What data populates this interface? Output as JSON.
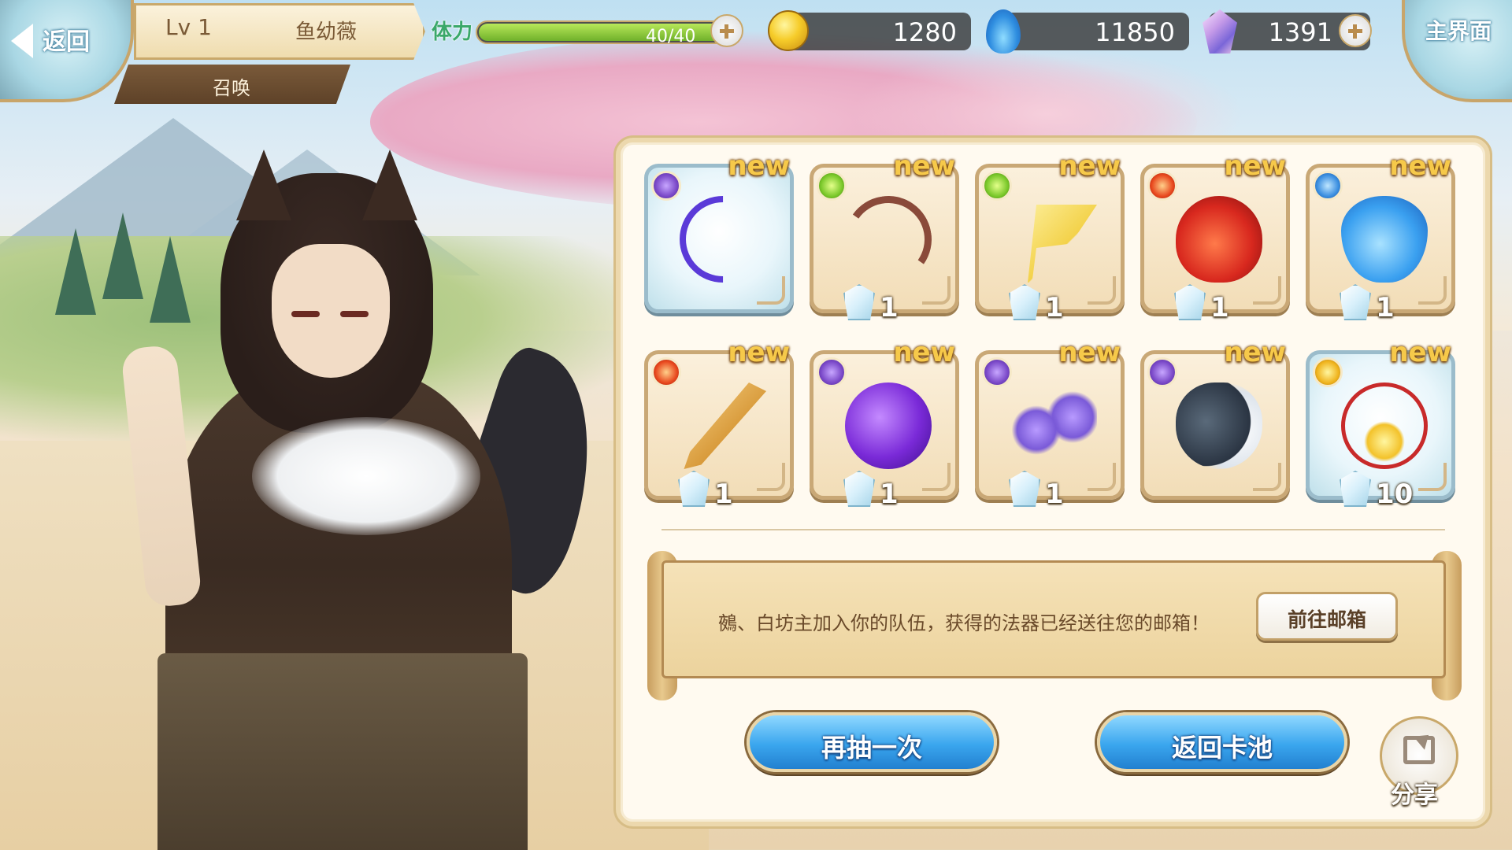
{
  "hud": {
    "back_label": "返回",
    "level": "Lv 1",
    "player_name": "鱼幼薇",
    "mode": "召唤",
    "stamina_label": "体力",
    "stamina_text": "40/40",
    "stamina_fraction": 1.0,
    "gold": "1280",
    "spirit": "11850",
    "crystal": "1391",
    "home_label": "主界面"
  },
  "rewards": [
    {
      "new_label": "new",
      "element": "purple",
      "art": "bow-purple",
      "rarity": "rare",
      "count": ""
    },
    {
      "new_label": "new",
      "element": "green",
      "art": "bow",
      "rarity": "normal",
      "count": "1"
    },
    {
      "new_label": "new",
      "element": "green",
      "art": "flag",
      "rarity": "normal",
      "count": "1"
    },
    {
      "new_label": "new",
      "element": "red",
      "art": "gourd-red",
      "rarity": "normal",
      "count": "1"
    },
    {
      "new_label": "new",
      "element": "blue",
      "art": "gourd-blue",
      "rarity": "normal",
      "count": "1"
    },
    {
      "new_label": "new",
      "element": "red",
      "art": "sword",
      "rarity": "normal",
      "count": "1"
    },
    {
      "new_label": "new",
      "element": "purple",
      "art": "gourd-purple",
      "rarity": "normal",
      "count": "1"
    },
    {
      "new_label": "new",
      "element": "purple",
      "art": "stars",
      "rarity": "normal",
      "count": "1"
    },
    {
      "new_label": "new",
      "element": "purple",
      "art": "mask",
      "rarity": "normal",
      "count": ""
    },
    {
      "new_label": "new",
      "element": "gold",
      "art": "charm",
      "rarity": "rare",
      "count": "10"
    }
  ],
  "message": {
    "text": "鵺、白坊主加入你的队伍，获得的法器已经送往您的邮箱！",
    "mail_button": "前往邮箱"
  },
  "actions": {
    "draw_again": "再抽一次",
    "back_to_pool": "返回卡池",
    "share": "分享"
  }
}
